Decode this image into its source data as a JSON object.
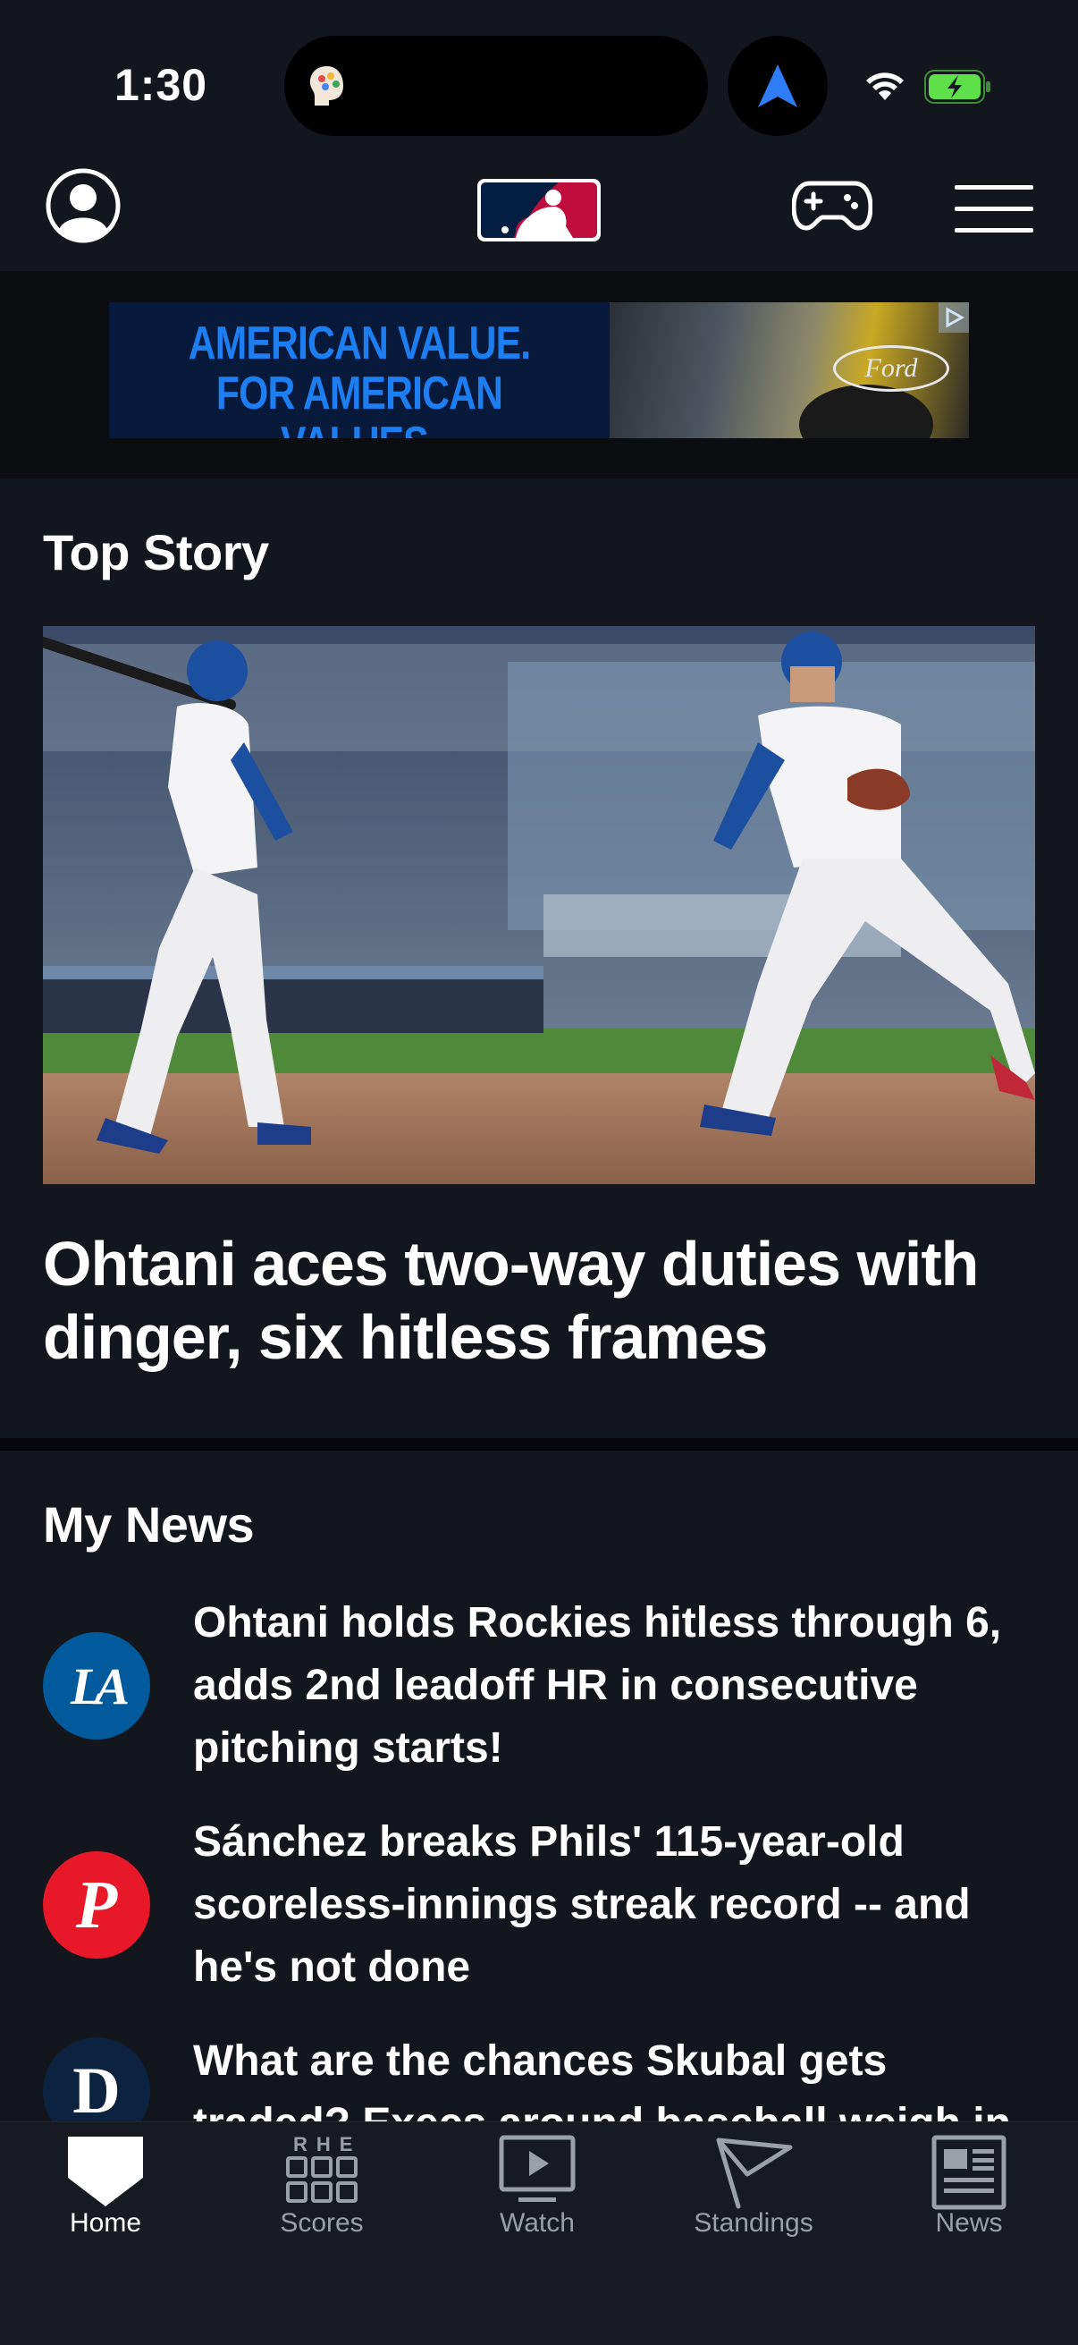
{
  "status_bar": {
    "time": "1:30",
    "icons": [
      "assistant-app-icon",
      "navigation-arrow-icon",
      "wifi-icon",
      "battery-charging-icon"
    ],
    "battery_color": "#5ee04a"
  },
  "header": {
    "icons": [
      "profile-icon",
      "mlb-logo",
      "games-controller-icon",
      "hamburger-menu-icon"
    ],
    "brand_colors": {
      "navy": "#041e42",
      "red": "#bf0d3e"
    }
  },
  "ad": {
    "line1": "AMERICAN VALUE.",
    "line2": "FOR AMERICAN VALUES.",
    "brand": "Ford",
    "text_color": "#1d7ef2"
  },
  "top_story": {
    "section_title": "Top Story",
    "headline": "Ohtani aces two-way duties with dinger, six hitless frames"
  },
  "my_news": {
    "section_title": "My News",
    "items": [
      {
        "team_logo": "dodgers-logo",
        "logo_text": "LA",
        "logo_color": "#005a9c",
        "headline": "Ohtani holds Rockies hitless through 6, adds 2nd leadoff HR in consecutive pitching starts!"
      },
      {
        "team_logo": "phillies-logo",
        "logo_text": "P",
        "logo_color": "#e81828",
        "headline": "Sánchez breaks Phils' 115-year-old scoreless-innings streak record -- and he's not done"
      },
      {
        "team_logo": "tigers-logo",
        "logo_text": "D",
        "logo_color": "#0c2340",
        "headline": "What are the chances Skubal gets traded? Execs around baseball weigh in"
      }
    ]
  },
  "tab_bar": {
    "active": "Home",
    "tabs": [
      {
        "label": "Home",
        "icon": "home-plate-icon"
      },
      {
        "label": "Scores",
        "icon": "scoreboard-rhe-icon",
        "icon_text": "RHE"
      },
      {
        "label": "Watch",
        "icon": "play-screen-icon"
      },
      {
        "label": "Standings",
        "icon": "pennant-flag-icon"
      },
      {
        "label": "News",
        "icon": "newspaper-icon"
      }
    ]
  }
}
